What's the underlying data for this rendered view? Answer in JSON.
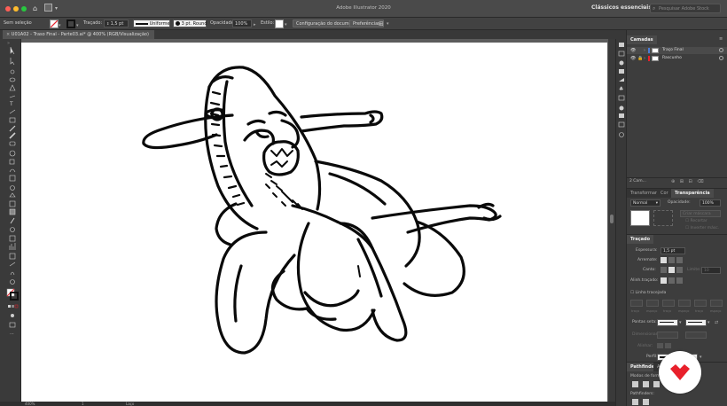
{
  "window": {
    "title": "Adobe Illustrator 2020",
    "workspace": "Clássicos essenciais",
    "stock_search_placeholder": "Pesquisar Adobe Stock"
  },
  "control_bar": {
    "selection": "Sem seleção",
    "stroke_label": "Traçado:",
    "stroke_weight": "1,5 pt",
    "profile": "Uniforme",
    "brush": "3 pt. Round",
    "opacity_label": "Opacidade:",
    "opacity_value": "100%",
    "style_label": "Estilo:",
    "doc_setup": "Configuração do documento",
    "preferences": "Preferências"
  },
  "document": {
    "tab_label": "U01A02 - Traso Final - Parte03.ai* @ 400% (RGB/Visualização)",
    "zoom": "400%",
    "page": "1",
    "tool_status": "Laço"
  },
  "layers_panel": {
    "title": "Camadas",
    "layers": [
      {
        "name": "Traço Final"
      },
      {
        "name": "Rascunho"
      }
    ],
    "count": "2 Cam..."
  },
  "transparency_panel": {
    "tabs": [
      "Transformar",
      "Cor",
      "Transparência"
    ],
    "blend_mode": "Normal",
    "opacity_label": "Opacidade:",
    "opacity_value": "100%",
    "make_mask": "Criar máscara",
    "clip": "Recortar",
    "invert": "Inverter másc."
  },
  "stroke_panel": {
    "title": "Traçado",
    "weight_label": "Espessura:",
    "weight_value": "1,5 pt",
    "cap_label": "Arremate:",
    "corner_label": "Canto:",
    "limit_label": "Limite:",
    "limit_value": "10",
    "align_label": "Alinh.traçado:",
    "dashed_label": "Linha tracejada",
    "dash_labels": [
      "traço",
      "espaço",
      "traço",
      "espaço",
      "traço",
      "espaço"
    ],
    "arrows_label": "Pontas seta:",
    "scale_label": "Dimensionar:",
    "align2_label": "Alinhar:",
    "profile_label": "Perfil:",
    "profile_value": "Uniforme"
  },
  "pathfinder_panel": {
    "tabs": [
      "Pathfinder",
      "Alinhar"
    ],
    "shape_modes": "Modos de forma:",
    "pathfinders": "Pathfinders:"
  },
  "colors": {
    "chrome": "#323232",
    "panel": "#3d3d3d",
    "artboard": "#ffffff",
    "accent": "#e8202b",
    "layer_color": "#4a7bd6"
  }
}
